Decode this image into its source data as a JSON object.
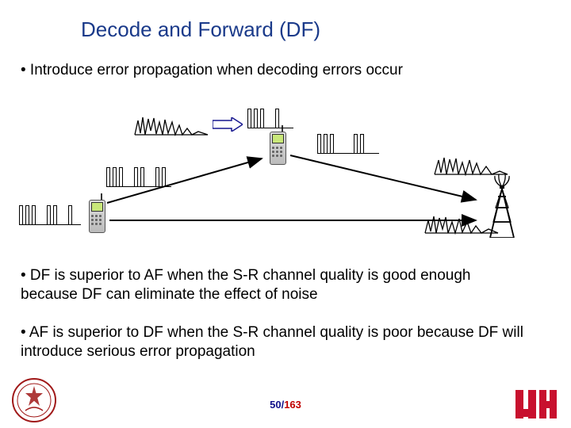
{
  "title": "Decode and Forward (DF)",
  "bullet1": "•  Introduce error propagation when decoding errors occur",
  "bullet2": "• DF is superior to AF when the S-R channel quality is good enough because DF can eliminate the effect of noise",
  "bullet3": "• AF is superior to DF when the S-R channel quality is poor because DF will introduce serious error propagation",
  "page": {
    "current": "50",
    "sep": "/",
    "total": "163"
  },
  "diagram": {
    "nodes": {
      "source": "source-phone",
      "relay": "relay-phone",
      "dest": "destination-tower"
    }
  }
}
